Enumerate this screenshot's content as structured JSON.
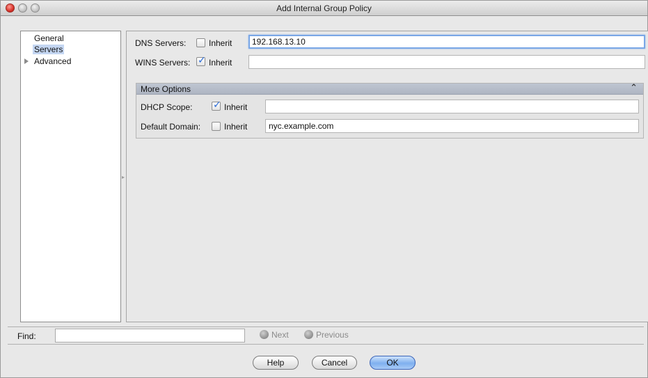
{
  "window": {
    "title": "Add Internal Group Policy"
  },
  "sidebar": {
    "items": [
      {
        "label": "General"
      },
      {
        "label": "Servers"
      },
      {
        "label": "Advanced"
      }
    ]
  },
  "servers": {
    "dns": {
      "label": "DNS Servers:",
      "inherit_label": "Inherit",
      "inherit_checked": false,
      "value": "192.168.13.10"
    },
    "wins": {
      "label": "WINS Servers:",
      "inherit_label": "Inherit",
      "inherit_checked": true,
      "value": ""
    }
  },
  "more_options": {
    "title": "More Options",
    "dhcp": {
      "label": "DHCP Scope:",
      "inherit_label": "Inherit",
      "inherit_checked": true,
      "value": ""
    },
    "domain": {
      "label": "Default Domain:",
      "inherit_label": "Inherit",
      "inherit_checked": false,
      "value": "nyc.example.com"
    }
  },
  "find": {
    "label": "Find:",
    "value": "",
    "next_label": "Next",
    "previous_label": "Previous"
  },
  "buttons": {
    "help": "Help",
    "cancel": "Cancel",
    "ok": "OK"
  },
  "colors": {
    "selection": "#c4d6f2",
    "focus": "#7aa7e6",
    "check": "#2a6bd6"
  }
}
